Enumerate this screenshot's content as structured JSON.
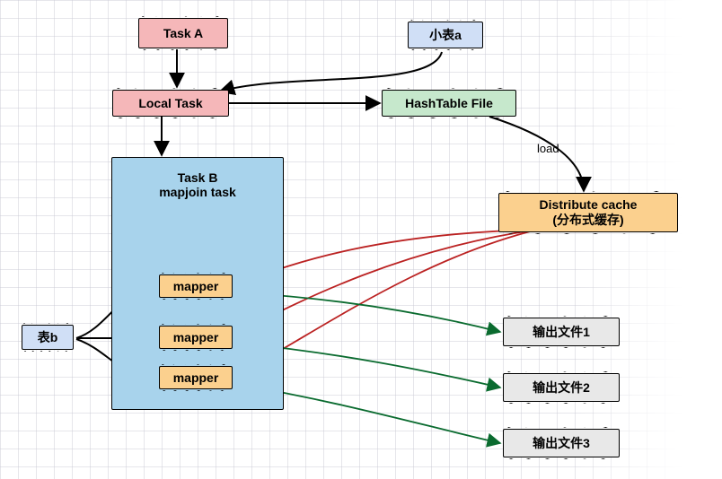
{
  "nodes": {
    "task_a": "Task A",
    "small_table_a": "小表a",
    "local_task": "Local Task",
    "hashtable_file": "HashTable File",
    "task_b_title": "Task B\nmapjoin task",
    "mapper1": "mapper",
    "mapper2": "mapper",
    "mapper3": "mapper",
    "table_b": "表b",
    "distribute_cache": "Distribute cache\n(分布式缓存)",
    "out1": "输出文件1",
    "out2": "输出文件2",
    "out3": "输出文件3"
  },
  "labels": {
    "load": "load"
  },
  "chart_data": {
    "type": "flow-diagram",
    "description": "Hive/Spark MapJoin execution flow",
    "nodes": [
      {
        "id": "task_a",
        "label": "Task A",
        "kind": "task"
      },
      {
        "id": "small_table_a",
        "label": "小表a",
        "kind": "input-small-table"
      },
      {
        "id": "local_task",
        "label": "Local Task",
        "kind": "task"
      },
      {
        "id": "hashtable_file",
        "label": "HashTable File",
        "kind": "file"
      },
      {
        "id": "distribute_cache",
        "label": "Distribute cache (分布式缓存)",
        "kind": "cache"
      },
      {
        "id": "task_b",
        "label": "Task B mapjoin task",
        "kind": "container"
      },
      {
        "id": "mapper1",
        "label": "mapper",
        "kind": "mapper",
        "parent": "task_b"
      },
      {
        "id": "mapper2",
        "label": "mapper",
        "kind": "mapper",
        "parent": "task_b"
      },
      {
        "id": "mapper3",
        "label": "mapper",
        "kind": "mapper",
        "parent": "task_b"
      },
      {
        "id": "table_b",
        "label": "表b",
        "kind": "input-big-table"
      },
      {
        "id": "out1",
        "label": "输出文件1",
        "kind": "output"
      },
      {
        "id": "out2",
        "label": "输出文件2",
        "kind": "output"
      },
      {
        "id": "out3",
        "label": "输出文件3",
        "kind": "output"
      }
    ],
    "edges": [
      {
        "from": "task_a",
        "to": "local_task"
      },
      {
        "from": "small_table_a",
        "to": "local_task"
      },
      {
        "from": "local_task",
        "to": "hashtable_file"
      },
      {
        "from": "local_task",
        "to": "task_b"
      },
      {
        "from": "hashtable_file",
        "to": "distribute_cache",
        "label": "load"
      },
      {
        "from": "distribute_cache",
        "to": "mapper1",
        "color": "red"
      },
      {
        "from": "distribute_cache",
        "to": "mapper2",
        "color": "red"
      },
      {
        "from": "distribute_cache",
        "to": "mapper3",
        "color": "red"
      },
      {
        "from": "table_b",
        "to": "mapper1"
      },
      {
        "from": "table_b",
        "to": "mapper2"
      },
      {
        "from": "table_b",
        "to": "mapper3"
      },
      {
        "from": "mapper1",
        "to": "out1",
        "color": "green"
      },
      {
        "from": "mapper2",
        "to": "out2",
        "color": "green"
      },
      {
        "from": "mapper3",
        "to": "out3",
        "color": "green"
      }
    ]
  }
}
